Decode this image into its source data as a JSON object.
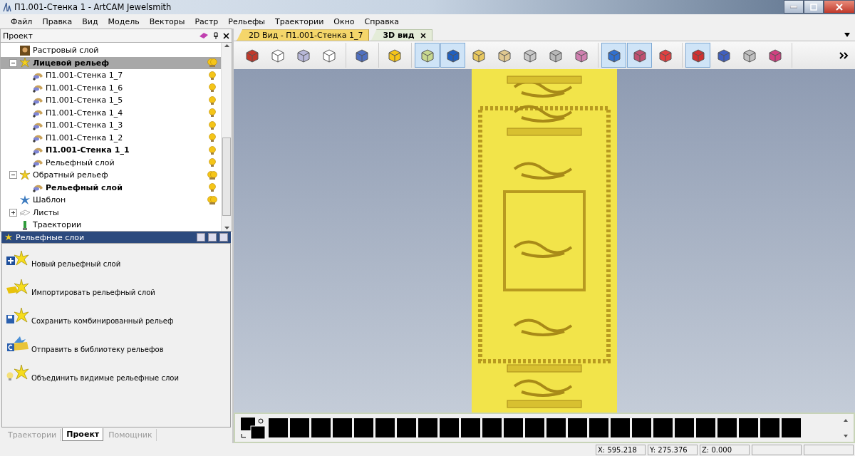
{
  "window": {
    "title": "П1.001-Стенка 1 - ArtCAM Jewelsmith"
  },
  "menu": [
    "Файл",
    "Правка",
    "Вид",
    "Модель",
    "Векторы",
    "Растр",
    "Рельефы",
    "Траектории",
    "Окно",
    "Справка"
  ],
  "project_panel": {
    "title": "Проект",
    "tree": [
      {
        "label": "Растровый слой",
        "kind": "raster",
        "bold": false,
        "selected": false
      },
      {
        "label": "Лицевой рельеф",
        "kind": "relief",
        "bold": true,
        "selected": true,
        "expanded": true,
        "visible": true,
        "children": [
          {
            "label": "П1.001-Стенка 1_7",
            "kind": "layer",
            "bold": false,
            "selected": false,
            "visible": true
          },
          {
            "label": "П1.001-Стенка 1_6",
            "kind": "layer",
            "bold": false,
            "selected": false,
            "visible": true
          },
          {
            "label": "П1.001-Стенка 1_5",
            "kind": "layer",
            "bold": false,
            "selected": false,
            "visible": true
          },
          {
            "label": "П1.001-Стенка 1_4",
            "kind": "layer",
            "bold": false,
            "selected": false,
            "visible": true
          },
          {
            "label": "П1.001-Стенка 1_3",
            "kind": "layer",
            "bold": false,
            "selected": false,
            "visible": true
          },
          {
            "label": "П1.001-Стенка 1_2",
            "kind": "layer",
            "bold": false,
            "selected": false,
            "visible": true
          },
          {
            "label": "П1.001-Стенка 1_1",
            "kind": "layer",
            "bold": true,
            "selected": false,
            "visible": true
          },
          {
            "label": "Рельефный слой",
            "kind": "layer",
            "bold": false,
            "selected": false,
            "visible": true
          }
        ]
      },
      {
        "label": "Обратный рельеф",
        "kind": "relief",
        "bold": false,
        "selected": false,
        "expanded": true,
        "visible": true,
        "children": [
          {
            "label": "Рельефный слой",
            "kind": "layer",
            "bold": true,
            "selected": false,
            "visible": true
          }
        ]
      },
      {
        "label": "Шаблон",
        "kind": "template",
        "bold": false,
        "selected": false,
        "visible": true
      },
      {
        "label": "Листы",
        "kind": "sheets",
        "bold": false,
        "selected": false,
        "expanded": false
      },
      {
        "label": "Траектории",
        "kind": "toolpaths",
        "bold": false,
        "selected": false
      }
    ]
  },
  "relief_layers_panel": {
    "title": "Рельефные слои",
    "actions": [
      {
        "label": "Новый рельефный слой",
        "kind": "new"
      },
      {
        "label": "Импортировать рельефный слой",
        "kind": "import"
      },
      {
        "label": "Сохранить комбинированный рельеф",
        "kind": "save"
      },
      {
        "label": "Отправить в библиотеку рельефов",
        "kind": "send"
      },
      {
        "label": "Объединить видимые рельефные слои",
        "kind": "merge"
      }
    ]
  },
  "bottom_tabs": [
    {
      "label": "Траектории",
      "selected": false
    },
    {
      "label": "Проект",
      "selected": true
    },
    {
      "label": "Помощник",
      "selected": false
    }
  ],
  "view_tabs": [
    {
      "label": "2D Вид - П1.001-Стенка 1_7",
      "selected": false
    },
    {
      "label": "3D вид",
      "selected": true
    }
  ],
  "toolbar": [
    [
      {
        "pressed": false
      },
      {
        "pressed": false
      },
      {
        "pressed": false
      },
      {
        "pressed": false
      }
    ],
    [
      {
        "pressed": false
      }
    ],
    [
      {
        "pressed": false
      }
    ],
    [
      {
        "pressed": true
      },
      {
        "pressed": true
      },
      {
        "pressed": false
      },
      {
        "pressed": false
      },
      {
        "pressed": false
      },
      {
        "pressed": false
      },
      {
        "pressed": false
      }
    ],
    [
      {
        "pressed": true
      },
      {
        "pressed": true
      },
      {
        "pressed": false
      }
    ],
    [
      {
        "pressed": true
      },
      {
        "pressed": false
      },
      {
        "pressed": false
      },
      {
        "pressed": false
      }
    ]
  ],
  "palette": [
    {
      "color": "#000000"
    },
    {
      "color": "#000000"
    },
    {
      "color": "#000000"
    },
    {
      "color": "#000000"
    },
    {
      "color": "#000000"
    },
    {
      "color": "#000000"
    },
    {
      "color": "#000000"
    },
    {
      "color": "#000000"
    },
    {
      "color": "#000000"
    },
    {
      "color": "#000000"
    },
    {
      "color": "#000000"
    },
    {
      "color": "#000000"
    },
    {
      "color": "#000000"
    },
    {
      "color": "#000000"
    },
    {
      "color": "#000000"
    },
    {
      "color": "#000000"
    },
    {
      "color": "#000000"
    },
    {
      "color": "#000000"
    },
    {
      "color": "#000000"
    },
    {
      "color": "#000000"
    },
    {
      "color": "#000000"
    },
    {
      "color": "#000000"
    },
    {
      "color": "#000000"
    },
    {
      "color": "#000000"
    },
    {
      "color": "#000000"
    }
  ],
  "status_bar": {
    "x": "X: 595.218",
    "y": "Y: 275.376",
    "z": "Z: 0.000"
  }
}
